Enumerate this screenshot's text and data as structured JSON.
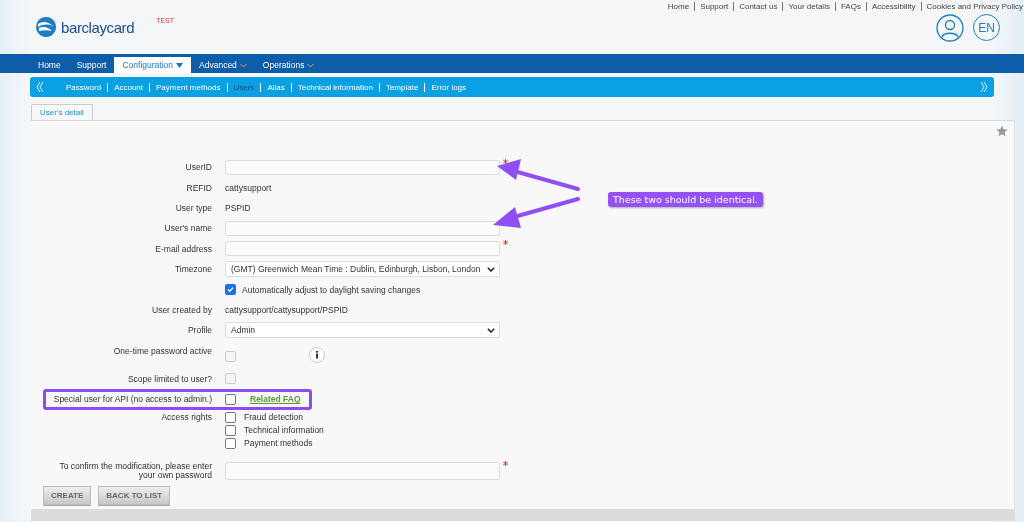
{
  "top_links": [
    "Home",
    "Support",
    "Contact us",
    "Your details",
    "FAQs",
    "Accessibility",
    "Cookies and Privacy Policy"
  ],
  "brand": {
    "name": "barclaycard",
    "environment": "TEST"
  },
  "language": "EN",
  "main_nav": [
    {
      "label": "Home",
      "selected": false,
      "dropdown": false
    },
    {
      "label": "Support",
      "selected": false,
      "dropdown": false
    },
    {
      "label": "Configuration",
      "selected": true,
      "dropdown": true
    },
    {
      "label": "Advanced",
      "selected": false,
      "dropdown": true
    },
    {
      "label": "Operations",
      "selected": false,
      "dropdown": true
    }
  ],
  "sub_nav": [
    {
      "label": "Password",
      "selected": false
    },
    {
      "label": "Account",
      "selected": false
    },
    {
      "label": "Payment methods",
      "selected": false
    },
    {
      "label": "Users",
      "selected": true
    },
    {
      "label": "Alias",
      "selected": false
    },
    {
      "label": "Technical information",
      "selected": false
    },
    {
      "label": "Template",
      "selected": false
    },
    {
      "label": "Error logs",
      "selected": false
    }
  ],
  "tabs": [
    {
      "label": "User's detail",
      "selected": true
    }
  ],
  "form": {
    "fields": [
      {
        "kind": "input",
        "label": "UserID",
        "required": true
      },
      {
        "kind": "text",
        "label": "REFID",
        "value": "cattysupport"
      },
      {
        "kind": "text",
        "label": "User type",
        "value": "PSPID"
      },
      {
        "kind": "input",
        "label": "User's name",
        "required": false
      },
      {
        "kind": "input",
        "label": "E-mail address",
        "required": true
      },
      {
        "kind": "select",
        "label": "Timezone",
        "value": "(GMT) Greenwich Mean Time : Dublin, Edinburgh, Lisbon, London"
      },
      {
        "kind": "checkbox",
        "option": "Automatically adjust to daylight saving changes",
        "checked": true,
        "disabled": false
      },
      {
        "kind": "text",
        "label": "User created by",
        "value": "cattysupport/cattysupport/PSPID"
      },
      {
        "kind": "select",
        "label": "Profile",
        "value": "Admin"
      },
      {
        "kind": "checkbox",
        "label": "One-time password active",
        "checked": false,
        "disabled": true,
        "info": true
      },
      {
        "kind": "checkbox",
        "label": "Scope limited to user?",
        "checked": false,
        "disabled": true
      },
      {
        "kind": "checkbox",
        "label": "Special user for API (no access to admin.)",
        "checked": false,
        "disabled": false,
        "link": "Related FAQ",
        "highlighted": true
      },
      {
        "kind": "checklist",
        "label": "Access rights",
        "options": [
          {
            "label": "Fraud detection",
            "checked": false
          },
          {
            "label": "Technical information",
            "checked": false
          },
          {
            "label": "Payment methods",
            "checked": false
          }
        ]
      },
      {
        "kind": "password",
        "label": "To confirm the modification, please enter your own password",
        "required": true
      }
    ]
  },
  "buttons": [
    "CREATE",
    "BACK TO LIST"
  ],
  "annotation": {
    "note": "These two should be identical."
  }
}
